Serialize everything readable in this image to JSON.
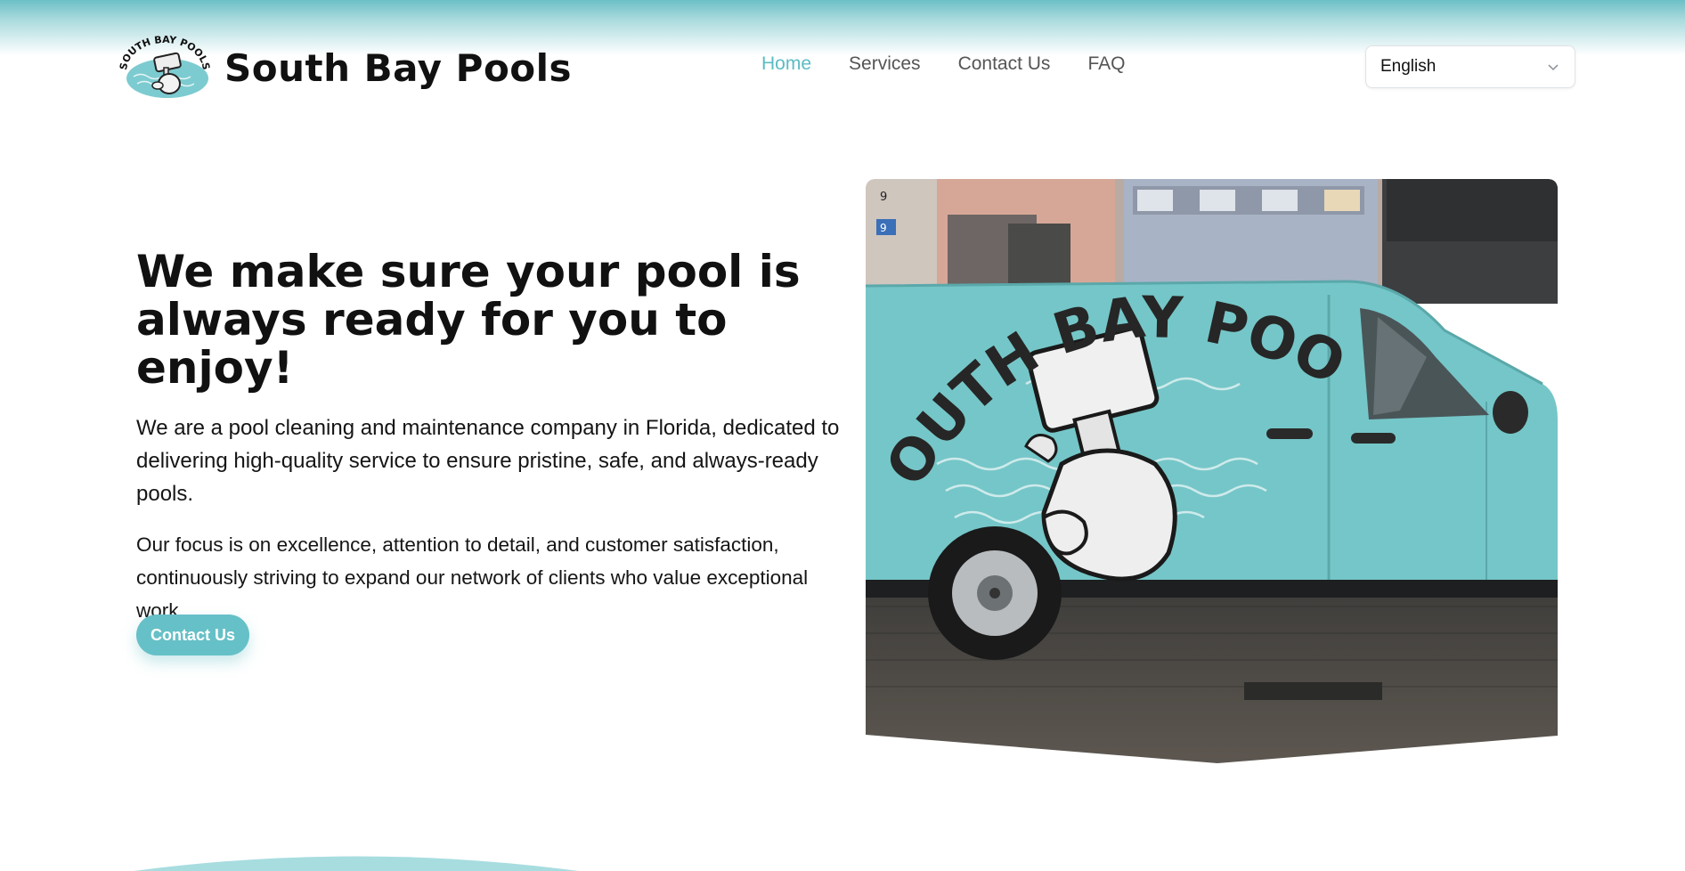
{
  "header": {
    "brand_name": "South Bay Pools",
    "logo_text": "SOUTH BAY POOLS"
  },
  "nav": {
    "items": [
      {
        "label": "Home",
        "active": true
      },
      {
        "label": "Services",
        "active": false
      },
      {
        "label": "Contact Us",
        "active": false
      },
      {
        "label": "FAQ",
        "active": false
      }
    ]
  },
  "language": {
    "selected": "English",
    "icon": "chevron-down-icon"
  },
  "hero": {
    "title": "We make sure your pool is always ready for you to enjoy!",
    "paragraph1": "We are a pool cleaning and maintenance company in Florida, dedicated to delivering high-quality service to ensure pristine, safe, and always-ready pools.",
    "paragraph2": "Our focus is on excellence, attention to detail, and customer satisfaction, continuously striving to expand our network of clients who value exceptional work.",
    "cta_label": "Contact Us",
    "van_text": "SOUTH BAY POOLS",
    "house_number": "9"
  },
  "colors": {
    "accent": "#5bbcc4",
    "button": "#66c0c7",
    "van": "#75c6c8"
  }
}
